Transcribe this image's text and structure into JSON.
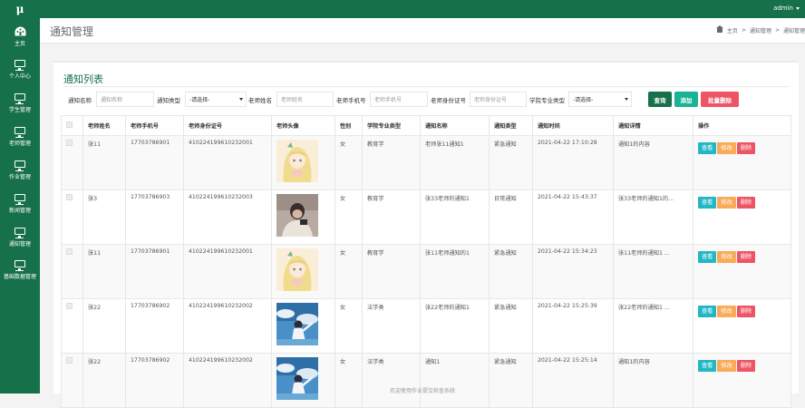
{
  "app": {
    "logo": "μ",
    "user": "admin"
  },
  "sidebar": {
    "items": [
      {
        "label": "主页",
        "icon": "palette-icon"
      },
      {
        "label": "个人中心",
        "icon": "monitor-icon"
      },
      {
        "label": "学生管理",
        "icon": "monitor-icon"
      },
      {
        "label": "老师管理",
        "icon": "monitor-icon"
      },
      {
        "label": "作业管理",
        "icon": "monitor-icon"
      },
      {
        "label": "新闻管理",
        "icon": "monitor-icon"
      },
      {
        "label": "通知管理",
        "icon": "monitor-icon"
      },
      {
        "label": "基础数据管理",
        "icon": "monitor-icon"
      }
    ]
  },
  "header": {
    "title": "通知管理",
    "breadcrumb": [
      "主页",
      "通知管理",
      "通知管理"
    ]
  },
  "card": {
    "title": "通知列表"
  },
  "search": {
    "notice_name_label": "通知名称",
    "notice_name_placeholder": "通知名称",
    "notice_type_label": "通知类型",
    "notice_type_value": "-请选择-",
    "teacher_name_label": "老师姓名",
    "teacher_name_placeholder": "老师姓名",
    "teacher_phone_label": "老师手机号",
    "teacher_phone_placeholder": "老师手机号",
    "teacher_id_label": "老师身份证号",
    "teacher_id_placeholder": "老师身份证号",
    "major_label": "学院专业类型",
    "major_value": "-请选择-",
    "query_btn": "查询",
    "add_btn": "添加",
    "batch_delete_btn": "批量删除"
  },
  "table": {
    "headers": [
      "老师姓名",
      "老师手机号",
      "老师身份证号",
      "老师头像",
      "性别",
      "学院专业类型",
      "通知名称",
      "通知类型",
      "通知时间",
      "通知详情",
      "操作"
    ],
    "actions": {
      "view": "查看",
      "edit": "修改",
      "delete": "删除"
    },
    "rows": [
      {
        "name": "张11",
        "phone": "17703786901",
        "idno": "410224199610232001",
        "avatar": "anime-girl",
        "gender": "女",
        "major": "教育学",
        "notice": "老师张11通知1",
        "type": "紧急通知",
        "time": "2021-04-22 17:10:28",
        "detail": "通知1的内容"
      },
      {
        "name": "张3",
        "phone": "17703786903",
        "idno": "410224199610232003",
        "avatar": "person-photo",
        "gender": "女",
        "major": "教育学",
        "notice": "张33老师的通知1",
        "type": "日常通知",
        "time": "2021-04-22 15:43:37",
        "detail": "张33老师的通知1的..."
      },
      {
        "name": "张11",
        "phone": "17703786901",
        "idno": "410224199610232001",
        "avatar": "anime-girl",
        "gender": "女",
        "major": "教育学",
        "notice": "张11老师通知的1",
        "type": "紧急通知",
        "time": "2021-04-22 15:34:23",
        "detail": "张11老师的通知1 ..."
      },
      {
        "name": "张22",
        "phone": "17703786902",
        "idno": "410224199610232002",
        "avatar": "sky-boy",
        "gender": "女",
        "major": "法学类",
        "notice": "张22老师的通知1",
        "type": "紧急通知",
        "time": "2021-04-22 15:25:39",
        "detail": "张22老师的通知1 ..."
      },
      {
        "name": "张22",
        "phone": "17703786902",
        "idno": "410224199610232002",
        "avatar": "sky-boy",
        "gender": "女",
        "major": "法学类",
        "notice": "通知1",
        "type": "紧急通知",
        "time": "2021-04-22 15:25:14",
        "detail": "通知1的内容"
      }
    ]
  },
  "footer": {
    "text": "欢迎使用作业提交检查系统"
  },
  "colors": {
    "brand": "#16704a",
    "view": "#23b7c5",
    "edit": "#f8ac59",
    "delete": "#ed5565",
    "add": "#1ab394"
  }
}
